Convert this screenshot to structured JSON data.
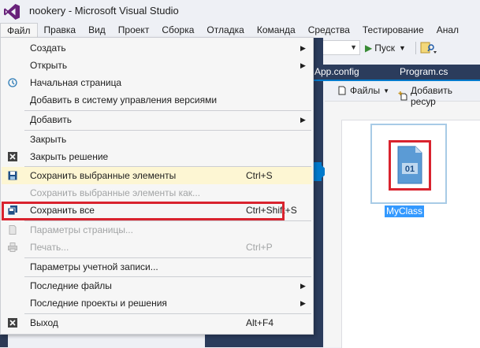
{
  "window": {
    "title": "nookery - Microsoft Visual Studio"
  },
  "menubar": {
    "items": [
      "Файл",
      "Правка",
      "Вид",
      "Проект",
      "Сборка",
      "Отладка",
      "Команда",
      "Средства",
      "Тестирование",
      "Анал"
    ]
  },
  "toolbar": {
    "run_label": "Пуск"
  },
  "tabs": [
    "App.config",
    "Program.cs"
  ],
  "designer": {
    "files_label": "Файлы",
    "add_resource_label": "Добавить ресур",
    "class_name": "MyClass",
    "class_icon_text": "01"
  },
  "file_menu": {
    "items": [
      {
        "label": "Создать",
        "shortcut": "",
        "submenu": true,
        "disabled": false
      },
      {
        "label": "Открыть",
        "shortcut": "",
        "submenu": true,
        "disabled": false
      },
      {
        "label": "Начальная страница",
        "shortcut": "",
        "submenu": false,
        "disabled": false
      },
      {
        "label": "Добавить в систему управления версиями",
        "shortcut": "",
        "submenu": false,
        "disabled": false
      },
      {
        "label": "Добавить",
        "shortcut": "",
        "submenu": true,
        "disabled": false
      },
      {
        "label": "Закрыть",
        "shortcut": "",
        "submenu": false,
        "disabled": false
      },
      {
        "label": "Закрыть решение",
        "shortcut": "",
        "submenu": false,
        "disabled": false
      },
      {
        "label": "Сохранить выбранные элементы",
        "shortcut": "Ctrl+S",
        "submenu": false,
        "disabled": false,
        "highlighted": true
      },
      {
        "label": "Сохранить выбранные элементы как...",
        "shortcut": "",
        "submenu": false,
        "disabled": true
      },
      {
        "label": "Сохранить все",
        "shortcut": "Ctrl+Shift+S",
        "submenu": false,
        "disabled": false
      },
      {
        "label": "Параметры страницы...",
        "shortcut": "",
        "submenu": false,
        "disabled": true
      },
      {
        "label": "Печать...",
        "shortcut": "Ctrl+P",
        "submenu": false,
        "disabled": true
      },
      {
        "label": "Параметры учетной записи...",
        "shortcut": "",
        "submenu": false,
        "disabled": false
      },
      {
        "label": "Последние файлы",
        "shortcut": "",
        "submenu": true,
        "disabled": false
      },
      {
        "label": "Последние проекты и решения",
        "shortcut": "",
        "submenu": true,
        "disabled": false
      },
      {
        "label": "Выход",
        "shortcut": "Alt+F4",
        "submenu": false,
        "disabled": false
      }
    ],
    "submenu_arrow": "▶"
  },
  "colors": {
    "accent": "#007acc",
    "highlight_frame": "#d9232e",
    "selection": "#3399ff"
  }
}
